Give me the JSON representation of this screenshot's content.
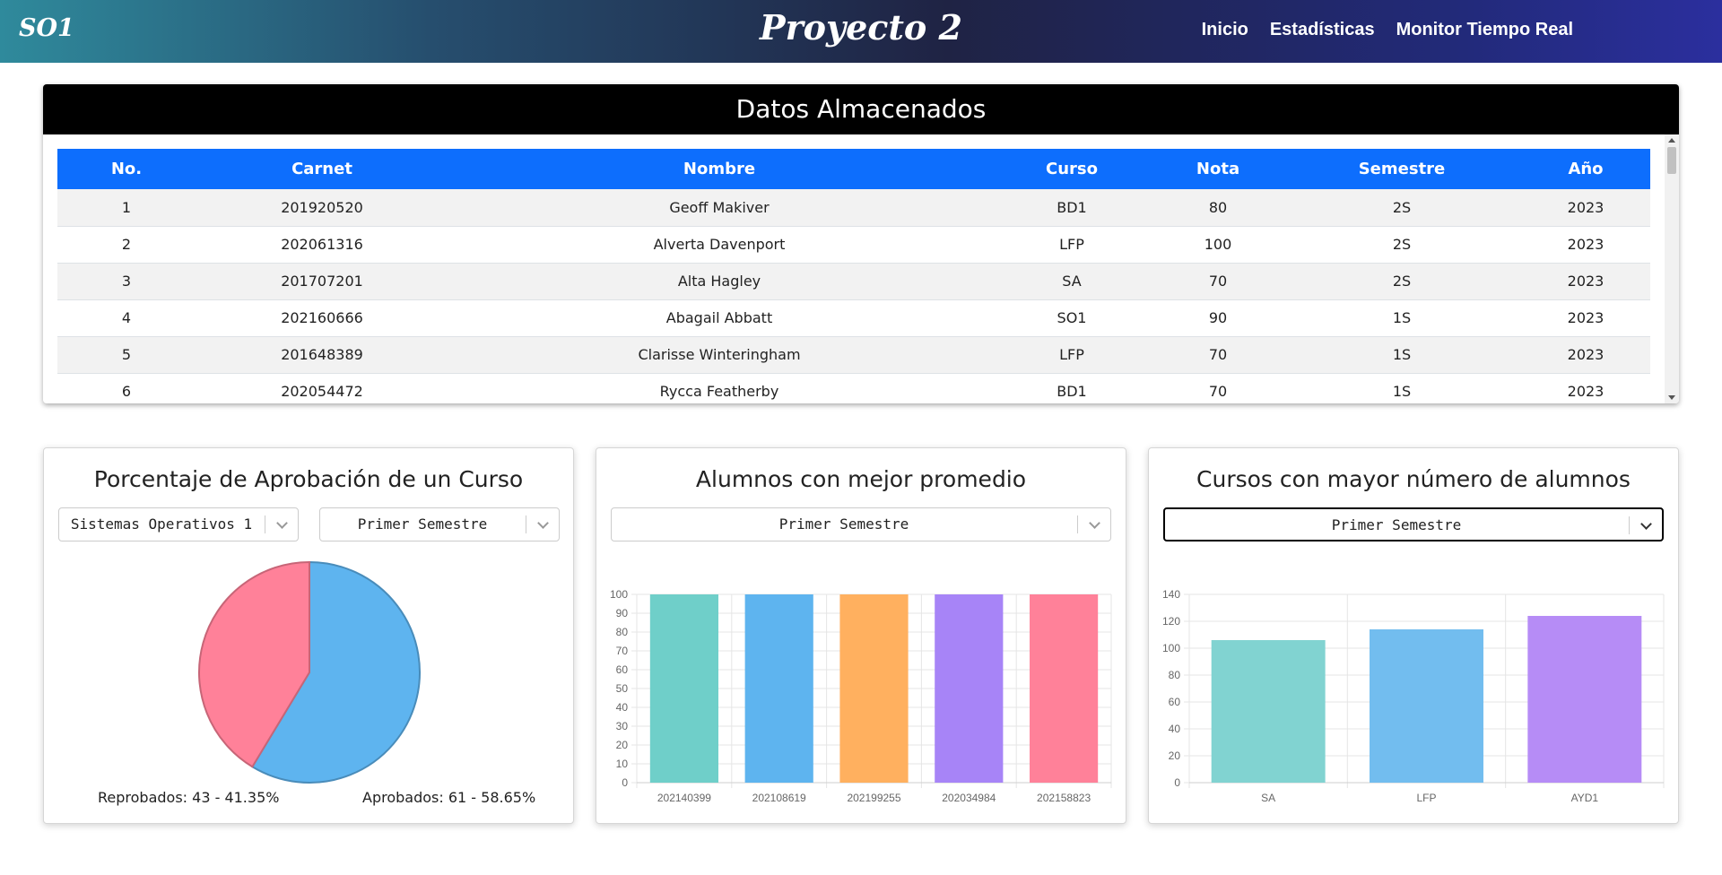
{
  "navbar": {
    "brand": "SO1",
    "title": "Proyecto 2",
    "links": [
      "Inicio",
      "Estadísticas",
      "Monitor Tiempo Real"
    ]
  },
  "table": {
    "title": "Datos Almacenados",
    "columns": [
      "No.",
      "Carnet",
      "Nombre",
      "Curso",
      "Nota",
      "Semestre",
      "Año"
    ],
    "rows": [
      [
        "1",
        "201920520",
        "Geoff Makiver",
        "BD1",
        "80",
        "2S",
        "2023"
      ],
      [
        "2",
        "202061316",
        "Alverta Davenport",
        "LFP",
        "100",
        "2S",
        "2023"
      ],
      [
        "3",
        "201707201",
        "Alta Hagley",
        "SA",
        "70",
        "2S",
        "2023"
      ],
      [
        "4",
        "202160666",
        "Abagail Abbatt",
        "SO1",
        "90",
        "1S",
        "2023"
      ],
      [
        "5",
        "201648389",
        "Clarisse Winteringham",
        "LFP",
        "70",
        "1S",
        "2023"
      ],
      [
        "6",
        "202054472",
        "Rycca Featherby",
        "BD1",
        "70",
        "1S",
        "2023"
      ]
    ]
  },
  "panels": {
    "approval": {
      "title": "Porcentaje de Aprobación de un Curso",
      "course_select": "Sistemas Operativos 1",
      "semester_select": "Primer Semestre",
      "failed_label": "Reprobados: 43 - 41.35%",
      "passed_label": "Aprobados: 61 - 58.65%"
    },
    "best_avg": {
      "title": "Alumnos con mejor promedio",
      "semester_select": "Primer Semestre"
    },
    "top_courses": {
      "title": "Cursos con mayor número de alumnos",
      "semester_select": "Primer Semestre"
    }
  },
  "chart_data": [
    {
      "type": "pie",
      "categories": [
        "Reprobados",
        "Aprobados"
      ],
      "values": [
        43,
        61
      ],
      "colors": [
        "#ff8199",
        "#5eb4ef"
      ]
    },
    {
      "type": "bar",
      "categories": [
        "202140399",
        "202108619",
        "202199255",
        "202034984",
        "202158823"
      ],
      "values": [
        100,
        100,
        100,
        100,
        100
      ],
      "ylim": [
        0,
        100
      ],
      "yticks": [
        0,
        10,
        20,
        30,
        40,
        50,
        60,
        70,
        80,
        90,
        100
      ],
      "colors": [
        "#6fcfc9",
        "#5eb4ef",
        "#ffb05f",
        "#a784f7",
        "#ff8199"
      ]
    },
    {
      "type": "bar",
      "categories": [
        "SA",
        "LFP",
        "AYD1"
      ],
      "values": [
        106,
        114,
        124
      ],
      "ylim": [
        0,
        140
      ],
      "yticks": [
        0,
        20,
        40,
        60,
        80,
        100,
        120,
        140
      ],
      "colors": [
        "#81d3d1",
        "#72bdef",
        "#b68cf6"
      ]
    }
  ]
}
